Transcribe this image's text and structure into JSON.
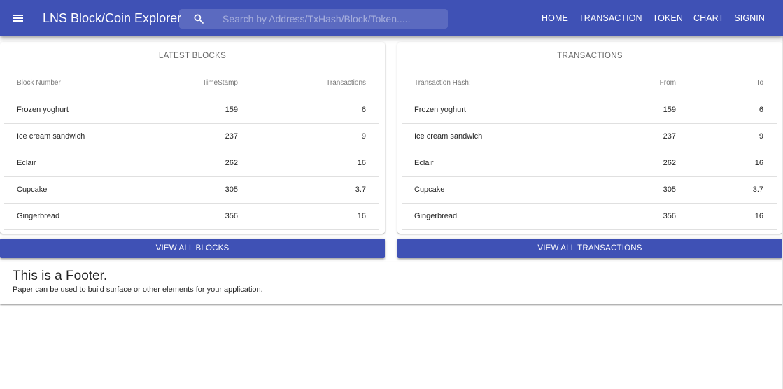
{
  "header": {
    "title": "LNS Block/Coin Explorer",
    "search_placeholder": "Search by Address/TxHash/Block/Token.....",
    "nav": [
      "HOME",
      "TRANSACTION",
      "TOKEN",
      "CHART",
      "SIGNIN"
    ],
    "color": "#3f51b5"
  },
  "blocks": {
    "title": "LATEST BLOCKS",
    "columns": [
      "Block Number",
      "TimeStamp",
      "Transactions"
    ],
    "rows": [
      [
        "Frozen yoghurt",
        "159",
        "6"
      ],
      [
        "Ice cream sandwich",
        "237",
        "9"
      ],
      [
        "Eclair",
        "262",
        "16"
      ],
      [
        "Cupcake",
        "305",
        "3.7"
      ],
      [
        "Gingerbread",
        "356",
        "16"
      ]
    ],
    "button": "VIEW ALL BLOCKS"
  },
  "transactions": {
    "title": "TRANSACTIONS",
    "columns": [
      "Transaction Hash:",
      "From",
      "To"
    ],
    "rows": [
      [
        "Frozen yoghurt",
        "159",
        "6"
      ],
      [
        "Ice cream sandwich",
        "237",
        "9"
      ],
      [
        "Eclair",
        "262",
        "16"
      ],
      [
        "Cupcake",
        "305",
        "3.7"
      ],
      [
        "Gingerbread",
        "356",
        "16"
      ]
    ],
    "button": "VIEW ALL TRANSACTIONS"
  },
  "footer": {
    "title": "This is a Footer.",
    "text": "Paper can be used to build surface or other elements for your application."
  },
  "icons": {
    "menu": "menu-icon",
    "search": "search-icon"
  }
}
